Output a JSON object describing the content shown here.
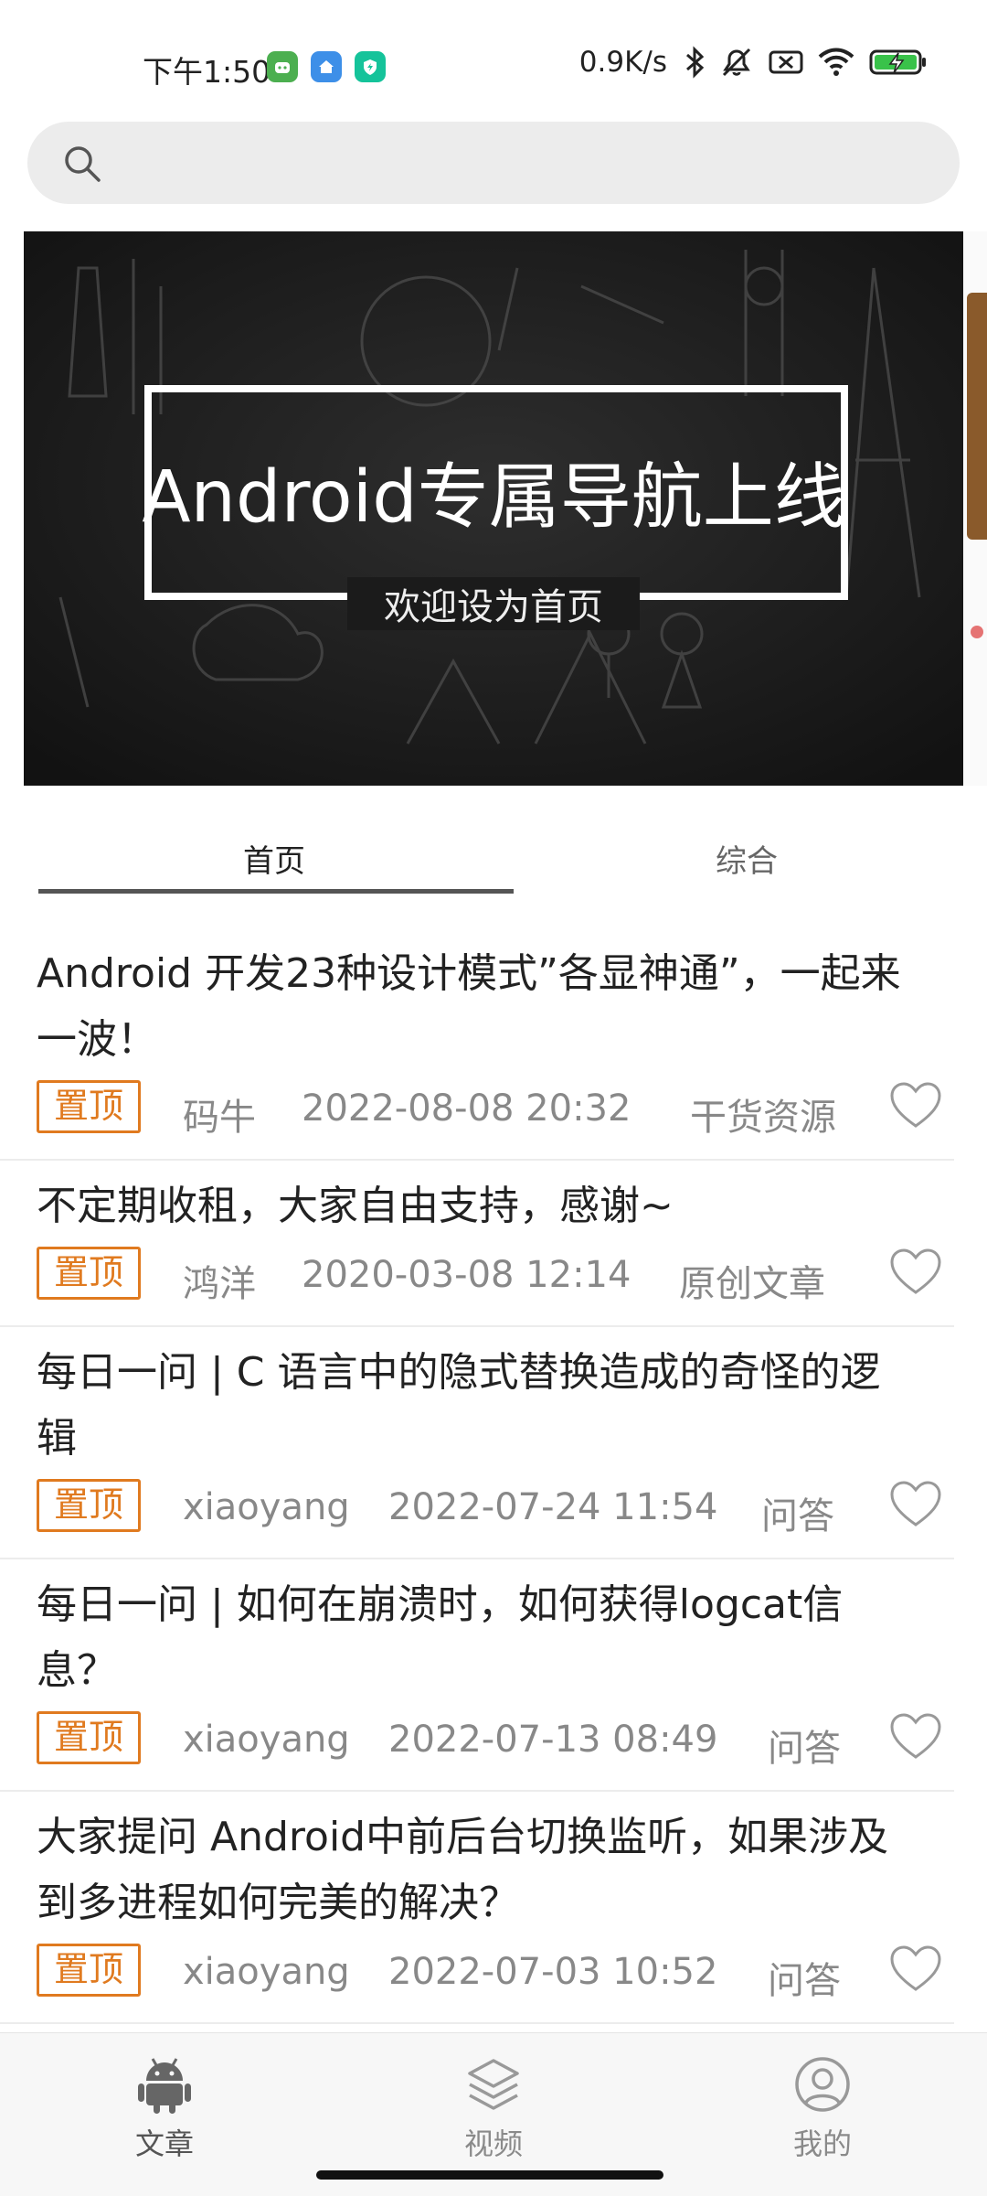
{
  "status_bar": {
    "time": "下午1:50",
    "net_speed": "0.9K/s",
    "app_icons": [
      "robot-app-icon",
      "home-app-icon",
      "shield-app-icon"
    ],
    "status_icons": [
      "bluetooth-icon",
      "mute-icon",
      "sim-off-icon",
      "wifi-icon",
      "battery-charging-icon"
    ]
  },
  "search": {
    "placeholder": ""
  },
  "banner": {
    "title": "Android专属导航上线",
    "subtitle": "欢迎设为首页",
    "page_count": 2,
    "active_page": 2
  },
  "tabs": [
    {
      "label": "首页",
      "selected": true
    },
    {
      "label": "综合",
      "selected": false
    }
  ],
  "articles": [
    {
      "title": "Android 开发23种设计模式”各显神通”，一起来一波！",
      "badge": "置顶",
      "author": "码牛",
      "date": "2022-08-08 20:32",
      "category": "干货资源"
    },
    {
      "title": "不定期收租，大家自由支持，感谢~",
      "badge": "置顶",
      "author": "鸿洋",
      "date": "2020-03-08 12:14",
      "category": "原创文章"
    },
    {
      "title": "每日一问 | C 语言中的隐式替换造成的奇怪的逻辑",
      "badge": "置顶",
      "author": "xiaoyang",
      "date": "2022-07-24 11:54",
      "category": "问答"
    },
    {
      "title": "每日一问 | 如何在崩溃时，如何获得logcat信息？",
      "badge": "置顶",
      "author": "xiaoyang",
      "date": "2022-07-13 08:49",
      "category": "问答"
    },
    {
      "title": "大家提问 Android中前后台切换监听，如果涉及到多进程如何完美的解决？",
      "badge": "置顶",
      "author": "xiaoyang",
      "date": "2022-07-03 10:52",
      "category": "问答"
    }
  ],
  "bottom_nav": [
    {
      "label": "文章",
      "icon": "android-icon",
      "selected": true
    },
    {
      "label": "视频",
      "icon": "layers-icon",
      "selected": false
    },
    {
      "label": "我的",
      "icon": "person-icon",
      "selected": false
    }
  ],
  "colors": {
    "accent": "#e07a1f",
    "tab_indicator": "#555555",
    "meta_text": "#888888"
  }
}
